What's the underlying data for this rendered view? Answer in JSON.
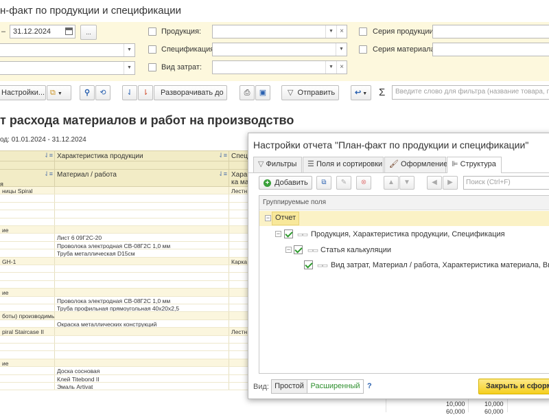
{
  "window": {
    "title": "н-факт по продукции и спецификации"
  },
  "filters": {
    "date_sep": "–",
    "date_to": "31.12.2024",
    "date_more": "...",
    "product_label": "Продукция:",
    "spec_label": "Спецификация:",
    "cost_type_label": "Вид затрат:",
    "product_series_label": "Серия продукции:",
    "material_series_label": "Серия материала:"
  },
  "toolbar": {
    "settings_label": "Настройки...",
    "expand_label": "Разворачивать до",
    "send_label": "Отправить",
    "sum_icon": "Σ",
    "search_placeholder": "Введите слово для фильтра (название товара, по"
  },
  "report": {
    "title": "т расхода материалов и работ на производство",
    "period": "од: 01.01.2024 - 31.12.2024",
    "headers": {
      "h1_col2": "Характеристика продукции",
      "h1_col3": "Спец",
      "h1_col1_partial": "м",
      "h2_col2": "Материал / работа",
      "h2_col3a": "Хара",
      "h2_col3b": "ка ма",
      "h2_col1_partial": "я"
    },
    "rows": [
      {
        "c1": "ницы Spiral",
        "c2": "",
        "c3": "Лестн",
        "grp": true
      },
      {
        "c1": "",
        "c2": "",
        "c3": "",
        "grp": false
      },
      {
        "c1": "",
        "c2": "",
        "c3": "",
        "grp": false
      },
      {
        "c1": "",
        "c2": "",
        "c3": "",
        "grp": false
      },
      {
        "c1": "",
        "c2": "",
        "c3": "",
        "grp": false
      },
      {
        "c1": "ие",
        "c2": "",
        "c3": "",
        "grp": true
      },
      {
        "c1": "",
        "c2": "Лист 6 09Г2С-20",
        "c3": "",
        "grp": false
      },
      {
        "c1": "",
        "c2": "Проволока электродная СВ-08Г2С 1,0 мм",
        "c3": "",
        "grp": false
      },
      {
        "c1": "",
        "c2": "Труба металлическая D15см",
        "c3": "",
        "grp": false
      },
      {
        "c1": "GH-1",
        "c2": "",
        "c3": "Карка",
        "grp": true
      },
      {
        "c1": "",
        "c2": "",
        "c3": "",
        "grp": false
      },
      {
        "c1": "",
        "c2": "",
        "c3": "",
        "grp": false
      },
      {
        "c1": "",
        "c2": "",
        "c3": "",
        "grp": false
      },
      {
        "c1": "ие",
        "c2": "",
        "c3": "",
        "grp": true
      },
      {
        "c1": "",
        "c2": "Проволока электродная СВ-08Г2С 1,0 мм",
        "c3": "",
        "grp": false
      },
      {
        "c1": "",
        "c2": "Труба профильная прямоугольная 40х20х2,5",
        "c3": "",
        "grp": false
      },
      {
        "c1": "боты) производимые в процессе",
        "c2": "",
        "c3": "",
        "grp": true
      },
      {
        "c1": "",
        "c2": "Окраска металлических конструкций",
        "c3": "",
        "grp": false
      },
      {
        "c1": "piral Staircase II",
        "c2": "",
        "c3": "Лестн",
        "grp": true
      },
      {
        "c1": "",
        "c2": "",
        "c3": "",
        "grp": false
      },
      {
        "c1": "",
        "c2": "",
        "c3": "",
        "grp": false
      },
      {
        "c1": "",
        "c2": "",
        "c3": "",
        "grp": false
      },
      {
        "c1": "ие",
        "c2": "",
        "c3": "",
        "grp": true
      },
      {
        "c1": "",
        "c2": "Доска сосновая",
        "c3": "",
        "grp": false
      },
      {
        "c1": "",
        "c2": "Клей Titebond II",
        "c3": "",
        "grp": false
      },
      {
        "c1": "",
        "c2": "Эмаль Artivat",
        "c3": "",
        "grp": false
      }
    ],
    "bottom_numbers": [
      "10,000",
      "10,000",
      "60,000",
      "60,000"
    ]
  },
  "dialog": {
    "title": "Настройки отчета \"План-факт по продукции и спецификации\"",
    "tabs": [
      "Фильтры",
      "Поля и сортировки",
      "Оформление",
      "Структура"
    ],
    "add_label": "Добавить",
    "search_placeholder": "Поиск (Ctrl+F)",
    "grouped_fields_label": "Группируемые поля",
    "tree": {
      "root": "Отчет",
      "level1": "Продукция, Характеристика продукции, Спецификация",
      "level2": "Статья калькуляции",
      "level3": "Вид затрат, Материал / работа, Характеристика материала, Вид работ"
    },
    "view_label": "Вид:",
    "view_simple": "Простой",
    "view_extended": "Расширенный",
    "help": "?",
    "close_label": "Закрыть и сформ"
  }
}
